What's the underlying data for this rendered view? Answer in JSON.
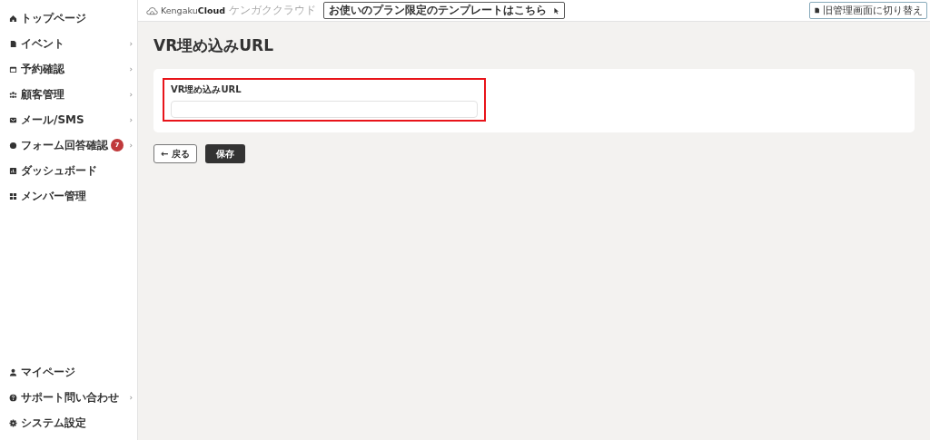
{
  "sidebar": {
    "items": [
      {
        "label": "トップページ"
      },
      {
        "label": "イベント",
        "chevron": "›"
      },
      {
        "label": "予約確認",
        "chevron": "›"
      },
      {
        "label": "顧客管理",
        "chevron": "›"
      },
      {
        "label": "メール/SMS",
        "chevron": "›"
      },
      {
        "label": "フォーム回答確認",
        "badge": "7",
        "chevron": "›"
      },
      {
        "label": "ダッシュボード"
      },
      {
        "label": "メンバー管理"
      }
    ],
    "bottom_items": [
      {
        "label": "マイページ"
      },
      {
        "label": "サポート問い合わせ",
        "chevron": "›"
      },
      {
        "label": "システム設定"
      }
    ]
  },
  "header": {
    "logo": {
      "brand_light": "Kengaku",
      "brand_bold": "Cloud",
      "subtitle": "ケンガククラウド"
    },
    "template_link": "お使いのプラン限定のテンプレートはこちら",
    "switch_button": "旧管理画面に切り替え"
  },
  "page": {
    "title": "VR埋め込みURL",
    "field": {
      "label": "VR埋め込みURL",
      "highlighted": true
    },
    "back_button": "← 戻る",
    "save_button": "保存"
  }
}
